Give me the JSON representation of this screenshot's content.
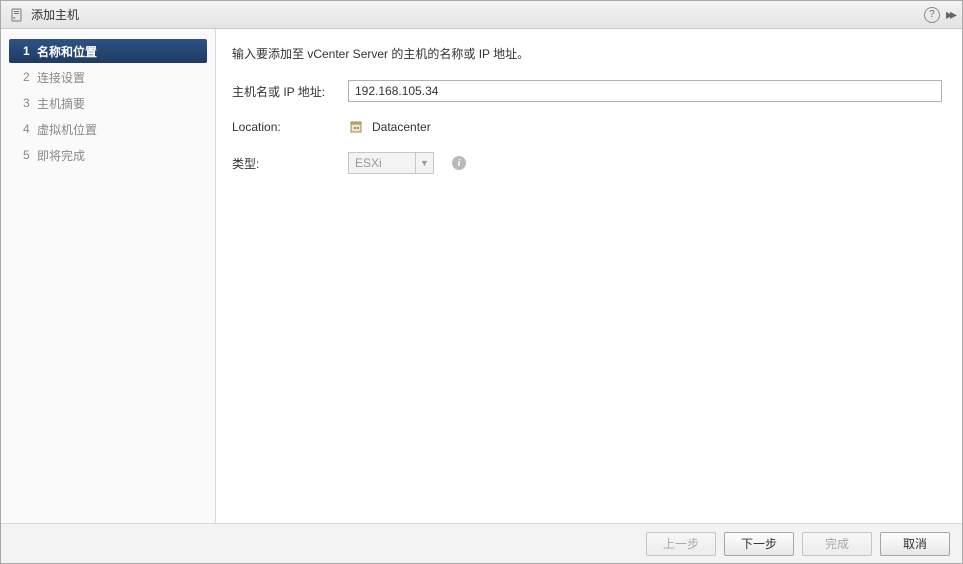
{
  "titlebar": {
    "title": "添加主机"
  },
  "sidebar": {
    "steps": [
      {
        "num": "1",
        "label": "名称和位置"
      },
      {
        "num": "2",
        "label": "连接设置"
      },
      {
        "num": "3",
        "label": "主机摘要"
      },
      {
        "num": "4",
        "label": "虚拟机位置"
      },
      {
        "num": "5",
        "label": "即将完成"
      }
    ]
  },
  "main": {
    "instruction": "输入要添加至 vCenter Server 的主机的名称或 IP 地址。",
    "hostname_label": "主机名或 IP 地址:",
    "hostname_value": "192.168.105.34",
    "location_label": "Location:",
    "location_value": "Datacenter",
    "type_label": "类型:",
    "type_value": "ESXi"
  },
  "footer": {
    "back": "上一步",
    "next": "下一步",
    "finish": "完成",
    "cancel": "取消"
  }
}
